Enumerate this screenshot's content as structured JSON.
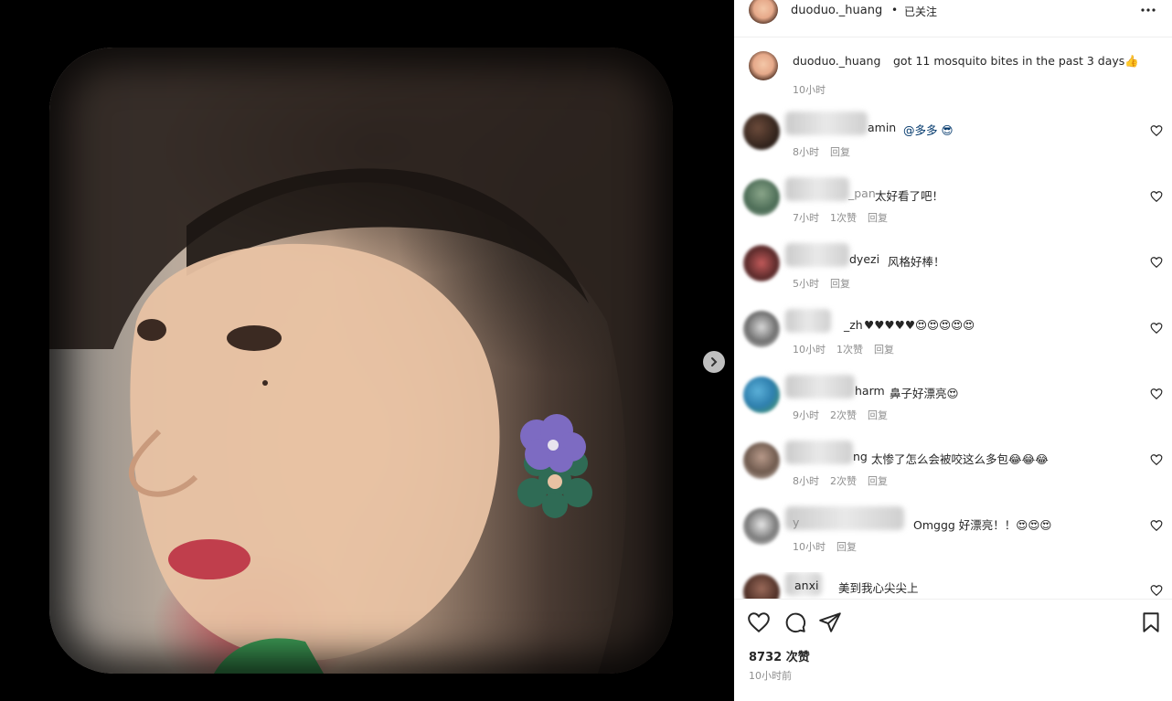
{
  "header": {
    "username": "duoduo._huang",
    "separator": "•",
    "follow_status": "已关注",
    "more_icon": "more-horizontal-icon"
  },
  "caption": {
    "username": "duoduo._huang",
    "text": "got 11 mosquito bites in the past 3 days👍",
    "time": "10小时"
  },
  "comments": [
    {
      "user": "amin",
      "text": "@多多 😎",
      "time": "8小时",
      "likes": "",
      "reply": "回复"
    },
    {
      "user": "_pan",
      "text": "太好看了吧！",
      "time": "7小时",
      "likes": "1次赞",
      "reply": "回复"
    },
    {
      "user": "dyezi",
      "text": "风格好棒！",
      "time": "5小时",
      "likes": "",
      "reply": "回复"
    },
    {
      "user": "_zh",
      "text": "♥♥♥♥♥😍😍😍😍😍",
      "time": "10小时",
      "likes": "1次赞",
      "reply": "回复"
    },
    {
      "user": "harm",
      "text": "鼻子好漂亮😍",
      "time": "9小时",
      "likes": "2次赞",
      "reply": "回复"
    },
    {
      "user": "ng",
      "text": "太惨了怎么会被咬这么多包😂😂😂",
      "time": "8小时",
      "likes": "2次赞",
      "reply": "回复"
    },
    {
      "user": "y",
      "text": "Omggg 好漂亮！！😍😍😍",
      "time": "10小时",
      "likes": "",
      "reply": "回复"
    },
    {
      "user": "anxi",
      "text": "美到我心尖尖上",
      "time": "",
      "likes": "",
      "reply": ""
    }
  ],
  "footer": {
    "likes": "8732 次赞",
    "time": "10小时前"
  },
  "colors": {
    "text": "#262626",
    "muted": "#8e8e8e",
    "mention": "#00376b",
    "background": "#ffffff"
  }
}
